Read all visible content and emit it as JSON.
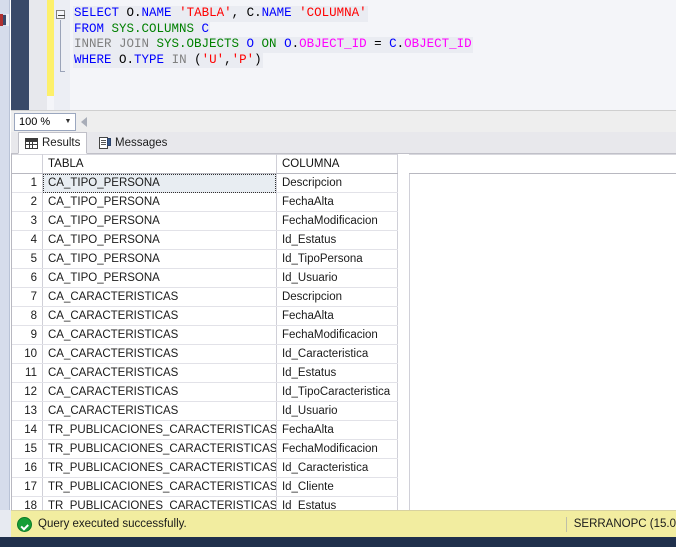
{
  "editor": {
    "zoom_level": "100 %",
    "outline_icon": "collapse-minus-icon",
    "code_lines": [
      {
        "id": "line-1",
        "tokens": [
          {
            "t": "SELECT ",
            "c": "kw"
          },
          {
            "t": "O",
            "c": "pln"
          },
          {
            "t": ".",
            "c": "pln"
          },
          {
            "t": "NAME ",
            "c": "blu"
          },
          {
            "t": "'TABLA'",
            "c": "str"
          },
          {
            "t": ", ",
            "c": "pln"
          },
          {
            "t": "C",
            "c": "pln"
          },
          {
            "t": ".",
            "c": "pln"
          },
          {
            "t": "NAME ",
            "c": "blu"
          },
          {
            "t": "'COLUMNA'",
            "c": "str"
          }
        ],
        "plain": "SELECT O.NAME 'TABLA', C.NAME 'COLUMNA'"
      },
      {
        "id": "line-2",
        "tokens": [
          {
            "t": "FROM ",
            "c": "kw"
          },
          {
            "t": "SYS.COLUMNS ",
            "c": "tbl"
          },
          {
            "t": "C",
            "c": "blu"
          }
        ],
        "plain": "FROM SYS.COLUMNS C"
      },
      {
        "id": "line-3",
        "tokens": [
          {
            "t": "INNER JOIN ",
            "c": "gry"
          },
          {
            "t": "SYS.OBJECTS ",
            "c": "tbl"
          },
          {
            "t": "O ",
            "c": "blu"
          },
          {
            "t": "ON ",
            "c": "tbl"
          },
          {
            "t": "O",
            "c": "blu"
          },
          {
            "t": ".",
            "c": "pln"
          },
          {
            "t": "OBJECT_ID ",
            "c": "col"
          },
          {
            "t": "= ",
            "c": "pln"
          },
          {
            "t": "C",
            "c": "blu"
          },
          {
            "t": ".",
            "c": "pln"
          },
          {
            "t": "OBJECT_ID",
            "c": "col"
          }
        ],
        "plain": "INNER JOIN SYS.OBJECTS O ON O.OBJECT_ID = C.OBJECT_ID"
      },
      {
        "id": "line-4",
        "tokens": [
          {
            "t": "WHERE ",
            "c": "kw"
          },
          {
            "t": "O",
            "c": "pln"
          },
          {
            "t": ".",
            "c": "pln"
          },
          {
            "t": "TYPE ",
            "c": "blu"
          },
          {
            "t": "IN ",
            "c": "gry"
          },
          {
            "t": "(",
            "c": "pln"
          },
          {
            "t": "'U'",
            "c": "str"
          },
          {
            "t": ",",
            "c": "pln"
          },
          {
            "t": "'P'",
            "c": "str"
          },
          {
            "t": ")",
            "c": "pln"
          }
        ],
        "plain": "WHERE O.TYPE IN ('U','P')"
      }
    ]
  },
  "result_tabs": [
    {
      "id": "tab-results",
      "label": "Results",
      "icon": "results-grid-icon",
      "active": true
    },
    {
      "id": "tab-messages",
      "label": "Messages",
      "icon": "messages-document-icon",
      "active": false
    }
  ],
  "grid": {
    "columns": [
      "",
      "TABLA",
      "COLUMNA"
    ],
    "selected_cell": {
      "row": 1,
      "column": "TABLA"
    },
    "rows": [
      {
        "n": "1",
        "tabla": "CA_TIPO_PERSONA",
        "columna": "Descripcion"
      },
      {
        "n": "2",
        "tabla": "CA_TIPO_PERSONA",
        "columna": "FechaAlta"
      },
      {
        "n": "3",
        "tabla": "CA_TIPO_PERSONA",
        "columna": "FechaModificacion"
      },
      {
        "n": "4",
        "tabla": "CA_TIPO_PERSONA",
        "columna": "Id_Estatus"
      },
      {
        "n": "5",
        "tabla": "CA_TIPO_PERSONA",
        "columna": "Id_TipoPersona"
      },
      {
        "n": "6",
        "tabla": "CA_TIPO_PERSONA",
        "columna": "Id_Usuario"
      },
      {
        "n": "7",
        "tabla": "CA_CARACTERISTICAS",
        "columna": "Descripcion"
      },
      {
        "n": "8",
        "tabla": "CA_CARACTERISTICAS",
        "columna": "FechaAlta"
      },
      {
        "n": "9",
        "tabla": "CA_CARACTERISTICAS",
        "columna": "FechaModificacion"
      },
      {
        "n": "10",
        "tabla": "CA_CARACTERISTICAS",
        "columna": "Id_Caracteristica"
      },
      {
        "n": "11",
        "tabla": "CA_CARACTERISTICAS",
        "columna": "Id_Estatus"
      },
      {
        "n": "12",
        "tabla": "CA_CARACTERISTICAS",
        "columna": "Id_TipoCaracteristica"
      },
      {
        "n": "13",
        "tabla": "CA_CARACTERISTICAS",
        "columna": "Id_Usuario"
      },
      {
        "n": "14",
        "tabla": "TR_PUBLICACIONES_CARACTERISTICAS",
        "columna": "FechaAlta"
      },
      {
        "n": "15",
        "tabla": "TR_PUBLICACIONES_CARACTERISTICAS",
        "columna": "FechaModificacion"
      },
      {
        "n": "16",
        "tabla": "TR_PUBLICACIONES_CARACTERISTICAS",
        "columna": "Id_Caracteristica"
      },
      {
        "n": "17",
        "tabla": "TR_PUBLICACIONES_CARACTERISTICAS",
        "columna": "Id_Cliente"
      },
      {
        "n": "18",
        "tabla": "TR_PUBLICACIONES_CARACTERISTICAS",
        "columna": "Id_Estatus"
      }
    ]
  },
  "status_bar": {
    "icon": "success-check-icon",
    "message": "Query executed successfully.",
    "server": "SERRANOPC (15.0"
  },
  "colors": {
    "status_bar_bg": "#f2eda0",
    "success_green": "#169e36",
    "keyword_blue": "#0000ff",
    "string_red": "#ff0000",
    "table_green": "#008000",
    "column_magenta": "#ff00ff",
    "comment_gray": "#808080",
    "change_bar_yellow": "#fdf06a",
    "selection_bg": "#e8edf2",
    "rail_navy": "#394a69",
    "taskbar_navy": "#20304c"
  }
}
